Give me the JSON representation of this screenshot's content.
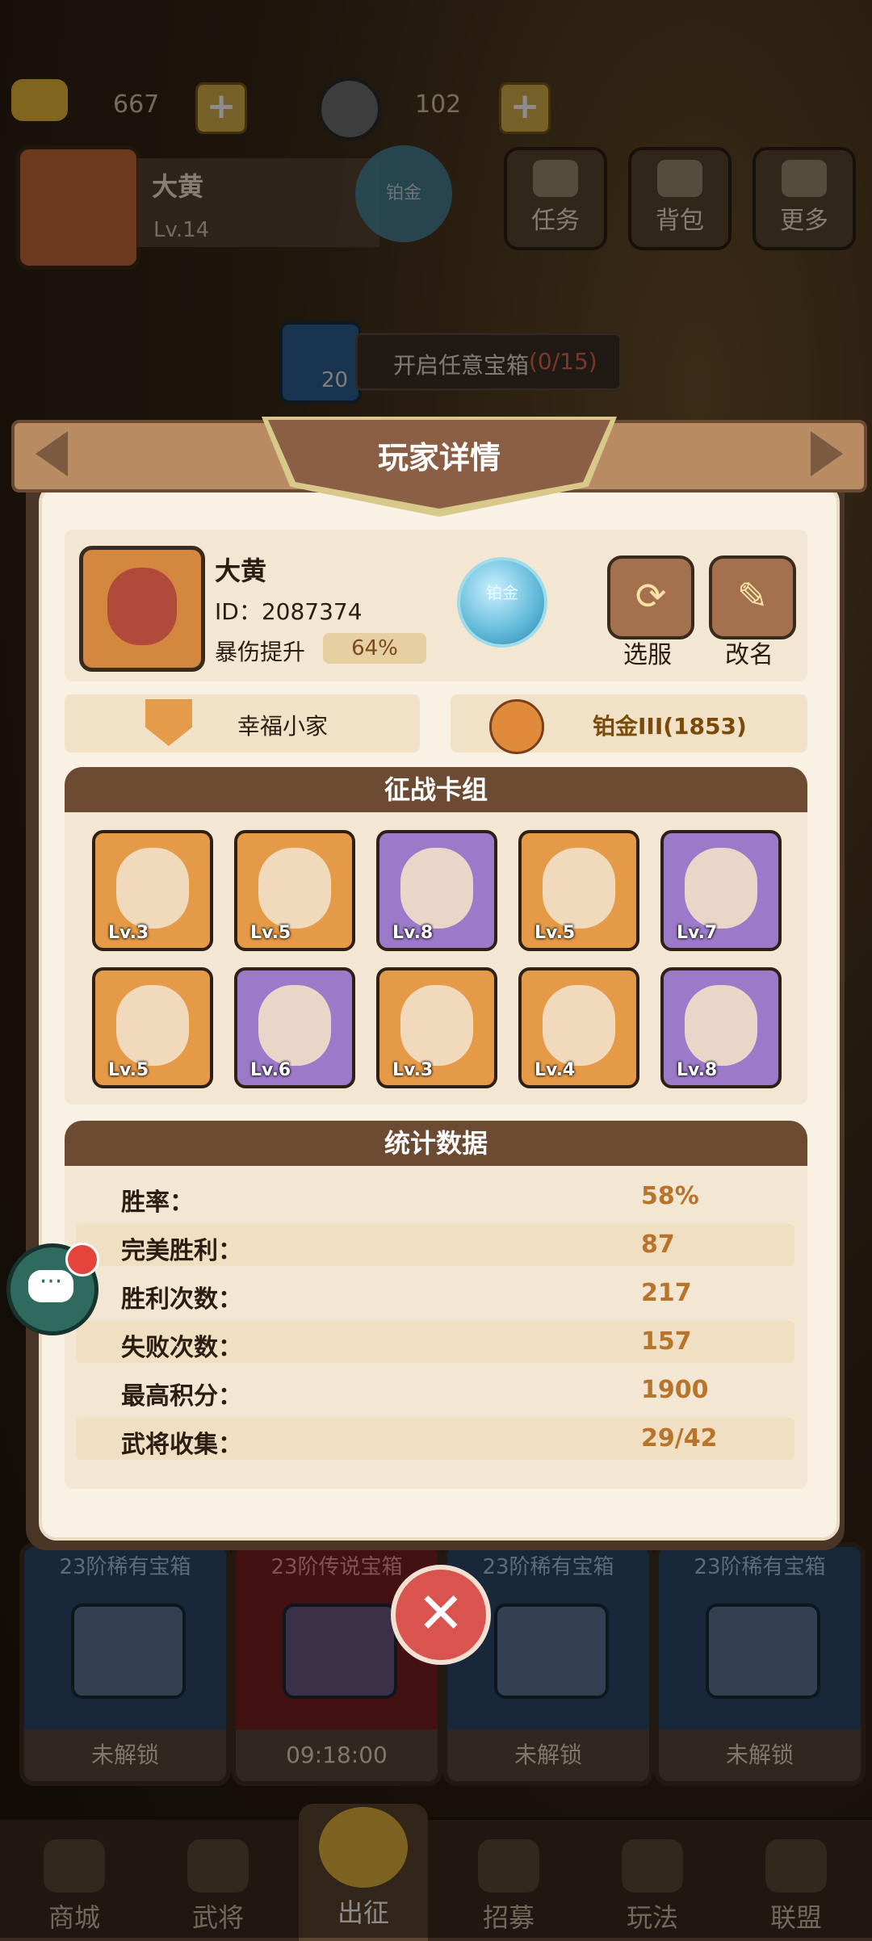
{
  "top_bar": {
    "gold_value": "667",
    "coin_value": "102",
    "player_name": "大黄",
    "player_level": "Lv.14",
    "rank_badge": "铂金",
    "buttons": [
      {
        "label": "任务",
        "icon": "scroll-icon"
      },
      {
        "label": "背包",
        "icon": "bag-icon"
      },
      {
        "label": "更多",
        "icon": "menu-icon"
      }
    ],
    "chest_task_count": "20",
    "chest_task_text": "开启任意宝箱",
    "chest_task_progress": "(0/15)"
  },
  "modal": {
    "title": "玩家详情",
    "profile": {
      "name": "大黄",
      "id": "ID：2087374",
      "crit_label": "暴伤提升",
      "crit_value": "64%",
      "rank_emblem": "铂金",
      "switch_server_label": "选服",
      "rename_label": "改名"
    },
    "guild_name": "幸福小家",
    "rank_text": "铂金III(1853)",
    "deck": {
      "title": "征战卡组",
      "cards": [
        {
          "level": "Lv.3",
          "rarity": "orange"
        },
        {
          "level": "Lv.5",
          "rarity": "orange"
        },
        {
          "level": "Lv.8",
          "rarity": "purple"
        },
        {
          "level": "Lv.5",
          "rarity": "orange"
        },
        {
          "level": "Lv.7",
          "rarity": "purple"
        },
        {
          "level": "Lv.5",
          "rarity": "orange"
        },
        {
          "level": "Lv.6",
          "rarity": "purple"
        },
        {
          "level": "Lv.3",
          "rarity": "orange"
        },
        {
          "level": "Lv.4",
          "rarity": "orange"
        },
        {
          "level": "Lv.8",
          "rarity": "purple"
        }
      ]
    },
    "stats": {
      "title": "统计数据",
      "rows": [
        {
          "label": "胜率：",
          "value": "58%"
        },
        {
          "label": "完美胜利：",
          "value": "87"
        },
        {
          "label": "胜利次数：",
          "value": "217"
        },
        {
          "label": "失败次数：",
          "value": "157"
        },
        {
          "label": "最高积分：",
          "value": "1900"
        },
        {
          "label": "武将收集：",
          "value": "29/42"
        }
      ]
    }
  },
  "chests": [
    {
      "title": "23阶稀有宝箱",
      "status": "未解锁",
      "kind": "blue"
    },
    {
      "title": "23阶传说宝箱",
      "status": "09:18:00",
      "kind": "red"
    },
    {
      "title": "23阶稀有宝箱",
      "status": "未解锁",
      "kind": "blue"
    },
    {
      "title": "23阶稀有宝箱",
      "status": "未解锁",
      "kind": "blue"
    }
  ],
  "nav": [
    {
      "label": "商城"
    },
    {
      "label": "武将"
    },
    {
      "label": "出征",
      "active": true
    },
    {
      "label": "招募"
    },
    {
      "label": "玩法"
    },
    {
      "label": "联盟"
    }
  ],
  "colors": {
    "accent_brown": "#6d4b33",
    "stat_value": "#b8742a",
    "close_red": "#d9534f"
  }
}
